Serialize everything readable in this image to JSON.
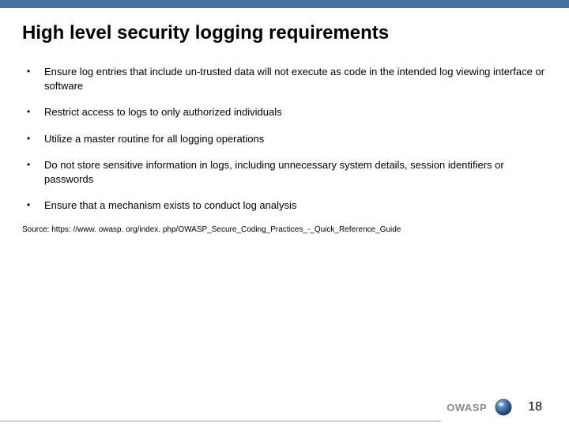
{
  "slide": {
    "title": "High level security logging requirements",
    "bullets": [
      "Ensure log entries that include un-trusted data will not execute as code in the intended log viewing interface or software",
      "Restrict access to logs to only authorized individuals",
      "Utilize a master routine for all logging operations",
      "Do not store sensitive information in logs, including unnecessary system details, session identifiers or passwords",
      "Ensure that a mechanism exists to conduct log analysis"
    ],
    "source": "Source: https: //www. owasp. org/index. php/OWASP_Secure_Coding_Practices_-_Quick_Reference_Guide"
  },
  "footer": {
    "brand": "OWASP",
    "page_number": "18"
  }
}
